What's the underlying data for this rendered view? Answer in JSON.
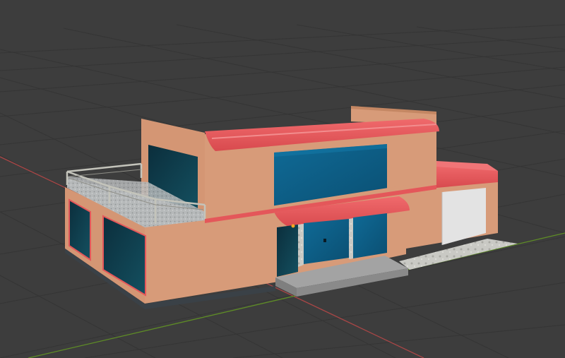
{
  "viewport": {
    "background_color": "#3d3d3d",
    "grid_line_color": "#353535",
    "x_axis_color": "#b04a4a",
    "y_axis_color": "#6a9a2a"
  },
  "model": {
    "wall_color": "#d79b79",
    "wall_shadow_color": "#c48763",
    "roof_trim_color": "#e8585a",
    "glass_color": "#0d5f86",
    "dark_glass_color": "#0f3340",
    "garage_door_color": "#e2e2e2",
    "step_color": "#9a9a9a",
    "railing_color": "#b8b8b0",
    "gravel_color": "#b9bcbd"
  }
}
